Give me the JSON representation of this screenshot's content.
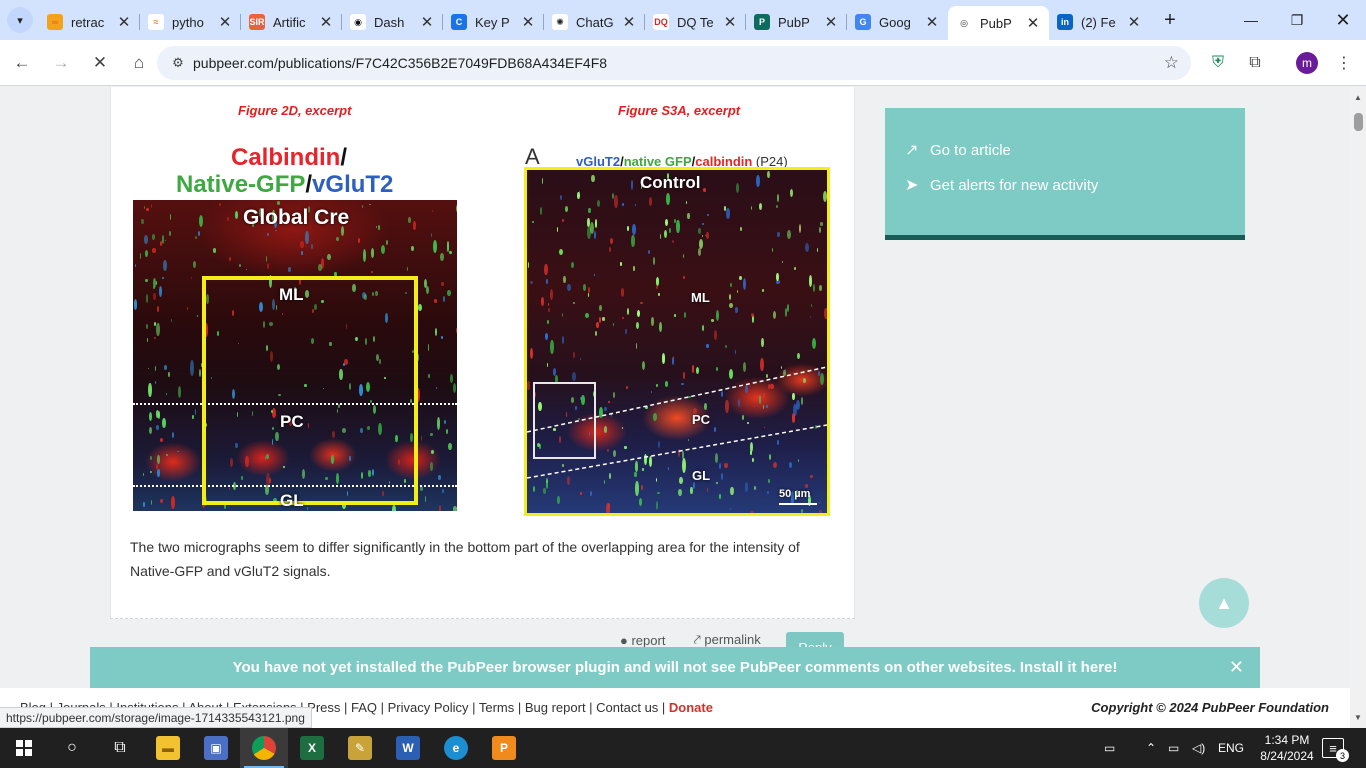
{
  "tabs": [
    {
      "title": "retrac",
      "fav_text": "∞",
      "fav_color": "#f4a21c",
      "fav_fg": "#e8701a"
    },
    {
      "title": "pytho",
      "fav_text": "≈",
      "fav_color": "#ffffff",
      "fav_fg": "#e0851d"
    },
    {
      "title": "Artific",
      "fav_text": "SIR",
      "fav_color": "#e8623a",
      "fav_fg": "#ffffff"
    },
    {
      "title": "Dash",
      "fav_text": "◉",
      "fav_color": "#ffffff",
      "fav_fg": "#111111"
    },
    {
      "title": "Key P",
      "fav_text": "C",
      "fav_color": "#1a73e8",
      "fav_fg": "#ffffff"
    },
    {
      "title": "ChatG",
      "fav_text": "✺",
      "fav_color": "#ffffff",
      "fav_fg": "#222222"
    },
    {
      "title": "DQ Te",
      "fav_text": "DQ",
      "fav_color": "#ffffff",
      "fav_fg": "#d6262b"
    },
    {
      "title": "PubP",
      "fav_text": "P",
      "fav_color": "#0f6b5d",
      "fav_fg": "#ffffff"
    },
    {
      "title": "Goog",
      "fav_text": "G",
      "fav_color": "#4285f4",
      "fav_fg": "#ffffff"
    },
    {
      "title": "PubP",
      "fav_text": "◎",
      "fav_color": "#ffffff",
      "fav_fg": "#333333",
      "active": true
    },
    {
      "title": "(2) Fe",
      "fav_text": "in",
      "fav_color": "#0a66c2",
      "fav_fg": "#ffffff"
    }
  ],
  "omnibox": {
    "url": "pubpeer.com/publications/F7C42C356B2E7049FDB68A434EF4F8"
  },
  "profile_initial": "m",
  "figure_left": {
    "caption": "Figure 2D, excerpt",
    "title_calbindin": "Calbindin",
    "title_slash1": "/",
    "title_gfp": "Native-GFP",
    "title_slash2": "/",
    "title_vglut2": "vGluT2",
    "label_global": "Global Cre",
    "label_ml": "ML",
    "label_pc": "PC",
    "label_gl": "GL"
  },
  "figure_right": {
    "caption": "Figure S3A, excerpt",
    "panel_letter": "A",
    "legend_vglut2": "vGluT2",
    "legend_slash1": "/",
    "legend_gfp": "native GFP",
    "legend_slash2": "/",
    "legend_calbindin": "calbindin",
    "legend_age": " (P24)",
    "label_control": "Control",
    "label_ml": "ML",
    "label_pc": "PC",
    "label_gl": "GL",
    "scale_bar": "50 µm"
  },
  "comment_text": "The two micrographs seem to differ significantly in the bottom part of the overlapping area for the intensity of Native-GFP and vGluT2 signals.",
  "comment_actions": {
    "report": "report",
    "permalink": "permalink",
    "reply": "Reply"
  },
  "sidebar": {
    "go_to_article": "Go to article",
    "get_alerts": "Get alerts for new activity"
  },
  "banner": {
    "message": "You have not yet installed the PubPeer browser plugin and will not see PubPeer comments on other websites.",
    "install_link": "Install it here!"
  },
  "footer": {
    "links_text": "Blog | Journals | Institutions | About | Extensions | Press | FAQ | Privacy Policy | Terms | Bug report | Contact us | ",
    "donate": "Donate",
    "copyright": "Copyright © 2024 PubPeer Foundation"
  },
  "status_url": "https://pubpeer.com/storage/image-1714335543121.png",
  "taskbar": {
    "time": "1:34 PM",
    "date": "8/24/2024",
    "language": "ENG",
    "notification_count": "3"
  },
  "colors": {
    "teal": "#7ecbc5",
    "teal_dark": "#175c56",
    "caption_red": "#e02020",
    "donate_red": "#d0322a"
  }
}
